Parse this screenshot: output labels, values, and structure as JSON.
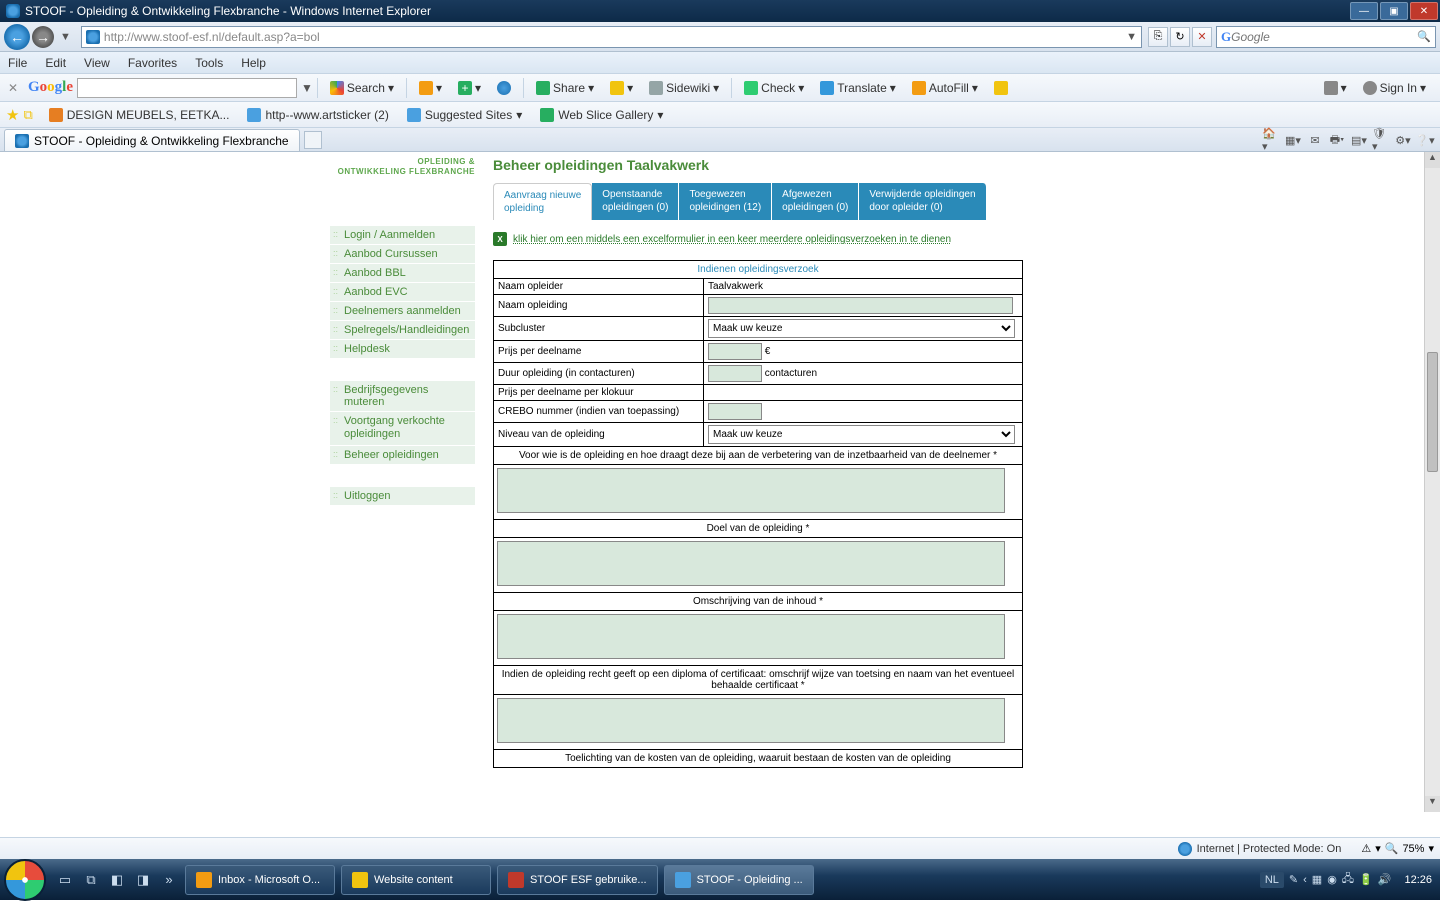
{
  "window": {
    "title": "STOOF - Opleiding & Ontwikkeling Flexbranche - Windows Internet Explorer"
  },
  "nav": {
    "url": "http://www.stoof-esf.nl/default.asp?a=bol",
    "search_placeholder": "Google"
  },
  "menubar": [
    "File",
    "Edit",
    "View",
    "Favorites",
    "Tools",
    "Help"
  ],
  "gtoolbar": {
    "search": "Search",
    "share": "Share",
    "sidewiki": "Sidewiki",
    "check": "Check",
    "translate": "Translate",
    "autofill": "AutoFill",
    "signin": "Sign In"
  },
  "favbar": [
    "DESIGN MEUBELS, EETKA...",
    "http--www.artsticker (2)",
    "Suggested Sites",
    "Web Slice Gallery"
  ],
  "tab": {
    "title": "STOOF - Opleiding & Ontwikkeling Flexbranche"
  },
  "sidebar": {
    "brand1": "OPLEIDING &",
    "brand2": "ONTWIKKELING FLEXBRANCHE",
    "group1": [
      "Login / Aanmelden",
      "Aanbod Cursussen",
      "Aanbod BBL",
      "Aanbod EVC",
      "Deelnemers aanmelden",
      "Spelregels/Handleidingen",
      "Helpdesk"
    ],
    "group2": [
      "Bedrijfsgegevens muteren",
      "Voortgang verkochte opleidingen",
      "Beheer opleidingen"
    ],
    "group3": [
      "Uitloggen"
    ]
  },
  "header": "Beheer opleidingen Taalvakwerk",
  "ctabs": [
    {
      "l1": "Aanvraag nieuwe",
      "l2": "opleiding"
    },
    {
      "l1": "Openstaande",
      "l2": "opleidingen (0)"
    },
    {
      "l1": "Toegewezen",
      "l2": "opleidingen (12)"
    },
    {
      "l1": "Afgewezen",
      "l2": "opleidingen (0)"
    },
    {
      "l1": "Verwijderde opleidingen",
      "l2": "door opleider (0)"
    }
  ],
  "excel_link": "klik hier om een middels een excelformulier in een keer meerdere opleidingsverzoeken in te dienen",
  "form": {
    "title": "Indienen opleidingsverzoek",
    "rows": {
      "naam_opleider_l": "Naam opleider",
      "naam_opleider_v": "Taalvakwerk",
      "naam_opleiding_l": "Naam opleiding",
      "subcluster_l": "Subcluster",
      "subcluster_opt": "Maak uw keuze",
      "prijs_l": "Prijs per deelname",
      "euro": "€",
      "duur_l": "Duur opleiding (in contacturen)",
      "duur_suffix": "contacturen",
      "klokuur_l": "Prijs per deelname per klokuur",
      "crebo_l": "CREBO nummer (indien van toepassing)",
      "niveau_l": "Niveau van de opleiding",
      "niveau_opt": "Maak uw keuze"
    },
    "sections": [
      "Voor wie is de opleiding en hoe draagt deze bij aan de verbetering van de inzetbaarheid van de deelnemer *",
      "Doel van de opleiding *",
      "Omschrijving van de inhoud *",
      "Indien de opleiding recht geeft op een diploma of certificaat: omschrijf wijze van toetsing en naam van het eventueel behaalde certificaat *",
      "Toelichting van de kosten van de opleiding, waaruit bestaan de kosten van de opleiding"
    ]
  },
  "status": {
    "zone": "Internet | Protected Mode: On",
    "zoom": "75%"
  },
  "taskbar": {
    "tasks": [
      "Inbox - Microsoft O...",
      "Website content",
      "STOOF ESF gebruike...",
      "STOOF - Opleiding ..."
    ],
    "lang": "NL",
    "time": "12:26"
  }
}
